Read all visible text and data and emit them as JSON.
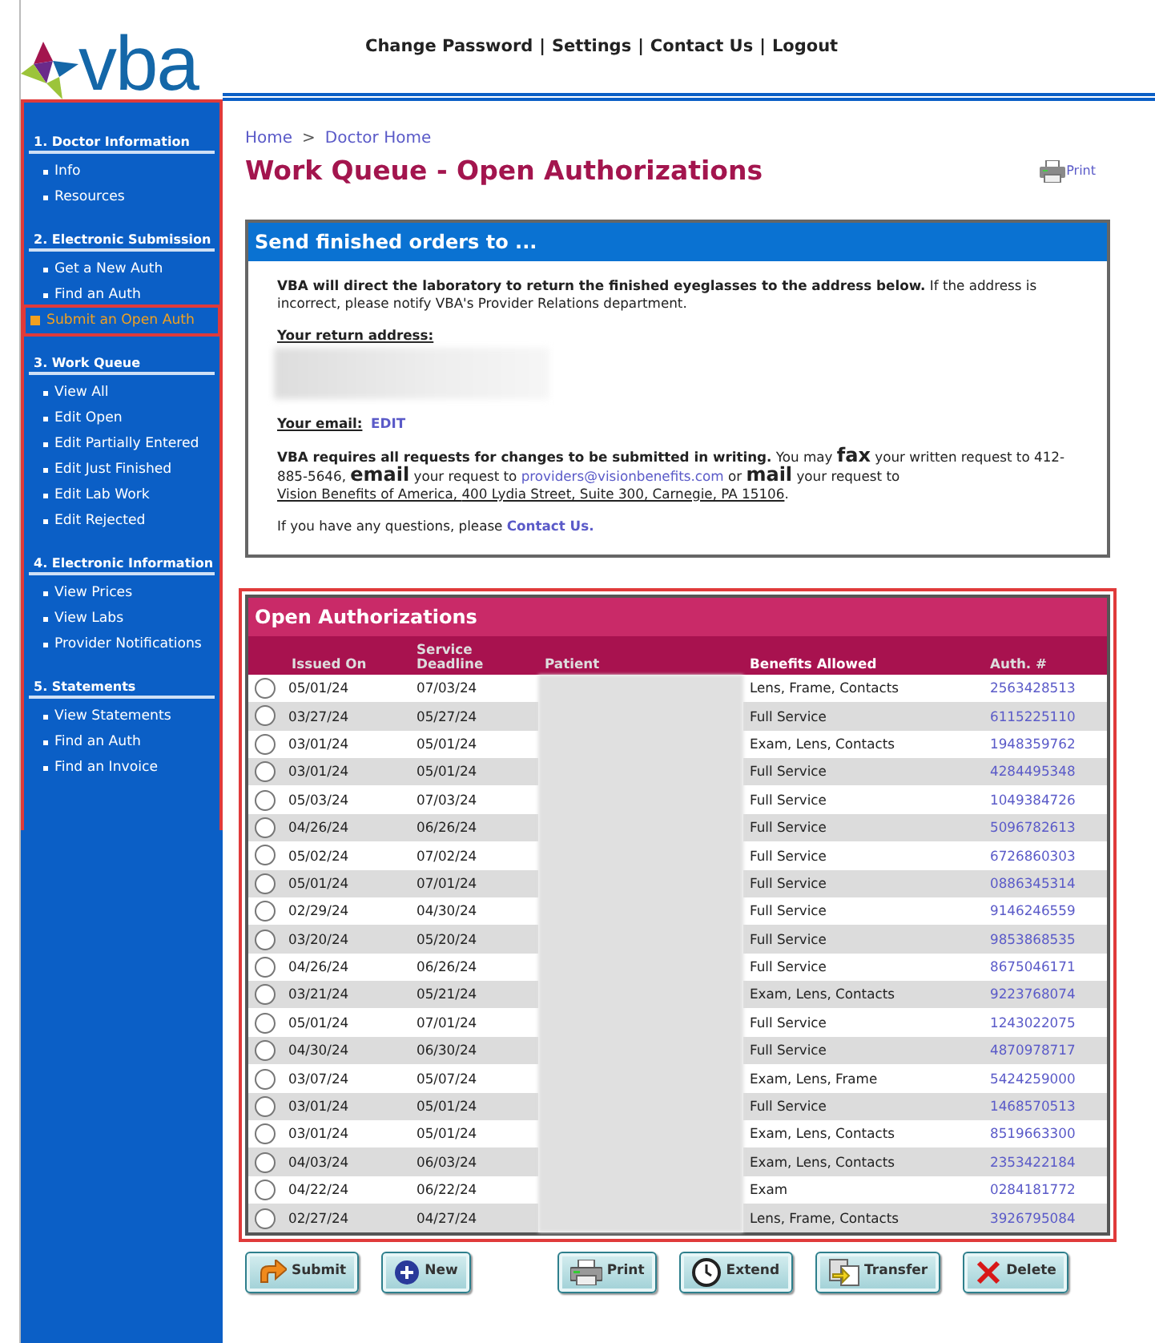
{
  "logo": {
    "text": "vba"
  },
  "top_links": {
    "separator": "|",
    "items": [
      "Change Password",
      "Settings",
      "Contact Us",
      "Logout"
    ]
  },
  "sidebar": [
    {
      "heading": "1. Doctor Information",
      "items": [
        {
          "label": "Info",
          "selected": false
        },
        {
          "label": "Resources",
          "selected": false
        }
      ]
    },
    {
      "heading": "2. Electronic Submission",
      "items": [
        {
          "label": "Get a New Auth",
          "selected": false
        },
        {
          "label": "Find an Auth",
          "selected": false
        },
        {
          "label": "Submit an Open Auth",
          "selected": true
        }
      ]
    },
    {
      "heading": "3. Work Queue",
      "items": [
        {
          "label": "View All",
          "selected": false
        },
        {
          "label": "Edit Open",
          "selected": false
        },
        {
          "label": "Edit Partially Entered",
          "selected": false
        },
        {
          "label": "Edit Just Finished",
          "selected": false
        },
        {
          "label": "Edit Lab Work",
          "selected": false
        },
        {
          "label": "Edit Rejected",
          "selected": false
        }
      ]
    },
    {
      "heading": "4. Electronic Information",
      "items": [
        {
          "label": "View Prices",
          "selected": false
        },
        {
          "label": "View Labs",
          "selected": false
        },
        {
          "label": "Provider Notifications",
          "selected": false
        }
      ]
    },
    {
      "heading": "5. Statements",
      "items": [
        {
          "label": "View Statements",
          "selected": false
        },
        {
          "label": "Find an Auth",
          "selected": false
        },
        {
          "label": "Find an Invoice",
          "selected": false
        }
      ]
    }
  ],
  "breadcrumb": {
    "separator": ">",
    "items": [
      "Home",
      "Doctor Home"
    ]
  },
  "page_title": "Work Queue - Open Authorizations",
  "print_link": "Print",
  "send_box": {
    "title": "Send finished orders to ...",
    "intro": "**VBA will direct the laboratory to return the finished eyeglasses to the address below.** If the address is incorrect, please notify VBA's Provider Relations department.",
    "address_label": "Your return address:",
    "email_label": "Your email:",
    "email_edit": "EDIT",
    "policy": [
      {
        "kind": "bold",
        "text": "VBA requires all requests for changes to be submitted in writing."
      },
      {
        "kind": "plain",
        "text": " You may "
      },
      {
        "kind": "big",
        "text": "fax"
      },
      {
        "kind": "plain",
        "text": " your written request to 412-885-5646, "
      },
      {
        "kind": "big",
        "text": "email"
      },
      {
        "kind": "plain",
        "text": " your request to "
      },
      {
        "kind": "link",
        "text": "providers@visionbenefits.com"
      },
      {
        "kind": "plain",
        "text": " or "
      },
      {
        "kind": "big",
        "text": "mail"
      },
      {
        "kind": "plain",
        "text": " your request to "
      },
      {
        "kind": "address",
        "text": "Vision Benefits of America, "
      },
      {
        "kind": "address",
        "text": "400 Lydia Street, Suite 300, Carnegie, PA 15106"
      },
      {
        "kind": "plain",
        "text": "."
      }
    ],
    "questions": "If you have any questions, please ",
    "questions_link": "Contact Us."
  },
  "auth_table": {
    "title": "Open Authorizations",
    "columns": [
      "Issued On",
      "Service Deadline",
      "Patient",
      "Benefits Allowed",
      "Auth. #"
    ],
    "rows": [
      {
        "selected": false,
        "issued": "05/01/24",
        "deadline": "07/03/24",
        "benefits": "Lens, Frame, Contacts",
        "auth": "2563428513"
      },
      {
        "selected": false,
        "issued": "03/27/24",
        "deadline": "05/27/24",
        "benefits": "Full Service",
        "auth": "6115225110"
      },
      {
        "selected": false,
        "issued": "03/01/24",
        "deadline": "05/01/24",
        "benefits": "Exam, Lens, Contacts",
        "auth": "1948359762"
      },
      {
        "selected": false,
        "issued": "03/01/24",
        "deadline": "05/01/24",
        "benefits": "Full Service",
        "auth": "4284495348"
      },
      {
        "selected": false,
        "issued": "05/03/24",
        "deadline": "07/03/24",
        "benefits": "Full Service",
        "auth": "1049384726"
      },
      {
        "selected": false,
        "issued": "04/26/24",
        "deadline": "06/26/24",
        "benefits": "Full Service",
        "auth": "5096782613"
      },
      {
        "selected": false,
        "issued": "05/02/24",
        "deadline": "07/02/24",
        "benefits": "Full Service",
        "auth": "6726860303"
      },
      {
        "selected": false,
        "issued": "05/01/24",
        "deadline": "07/01/24",
        "benefits": "Full Service",
        "auth": "0886345314"
      },
      {
        "selected": false,
        "issued": "02/29/24",
        "deadline": "04/30/24",
        "benefits": "Full Service",
        "auth": "9146246559"
      },
      {
        "selected": false,
        "issued": "03/20/24",
        "deadline": "05/20/24",
        "benefits": "Full Service",
        "auth": "9853868535"
      },
      {
        "selected": false,
        "issued": "04/26/24",
        "deadline": "06/26/24",
        "benefits": "Full Service",
        "auth": "8675046171"
      },
      {
        "selected": false,
        "issued": "03/21/24",
        "deadline": "05/21/24",
        "benefits": "Exam, Lens, Contacts",
        "auth": "9223768074"
      },
      {
        "selected": false,
        "issued": "05/01/24",
        "deadline": "07/01/24",
        "benefits": "Full Service",
        "auth": "1243022075"
      },
      {
        "selected": false,
        "issued": "04/30/24",
        "deadline": "06/30/24",
        "benefits": "Full Service",
        "auth": "4870978717"
      },
      {
        "selected": false,
        "issued": "03/07/24",
        "deadline": "05/07/24",
        "benefits": "Exam, Lens, Frame",
        "auth": "5424259000"
      },
      {
        "selected": false,
        "issued": "03/01/24",
        "deadline": "05/01/24",
        "benefits": "Full Service",
        "auth": "1468570513"
      },
      {
        "selected": false,
        "issued": "03/01/24",
        "deadline": "05/01/24",
        "benefits": "Exam, Lens, Contacts",
        "auth": "8519663300"
      },
      {
        "selected": false,
        "issued": "04/03/24",
        "deadline": "06/03/24",
        "benefits": "Exam, Lens, Contacts",
        "auth": "2353422184"
      },
      {
        "selected": false,
        "issued": "04/22/24",
        "deadline": "06/22/24",
        "benefits": "Exam",
        "auth": "0284181772"
      },
      {
        "selected": false,
        "issued": "02/27/24",
        "deadline": "04/27/24",
        "benefits": "Lens, Frame, Contacts",
        "auth": "3926795084"
      }
    ]
  },
  "actions": [
    {
      "kind": "submit",
      "label": "Submit"
    },
    {
      "kind": "new",
      "label": "New"
    },
    {
      "kind": "print",
      "label": "Print"
    },
    {
      "kind": "extend",
      "label": "Extend"
    },
    {
      "kind": "transfer",
      "label": "Transfer"
    },
    {
      "kind": "delete",
      "label": "Delete"
    }
  ]
}
